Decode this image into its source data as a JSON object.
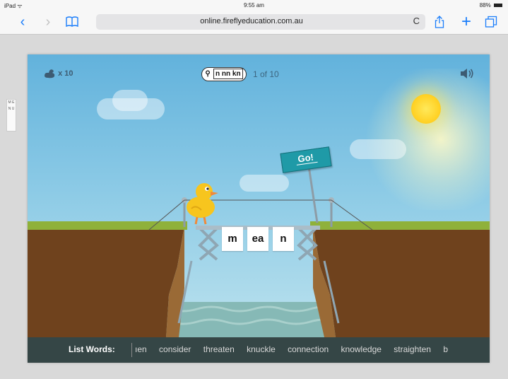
{
  "status_bar": {
    "carrier": "iPad ᯤ",
    "time": "9:55 am",
    "battery": "88%"
  },
  "browser": {
    "back": "‹",
    "forward": "›",
    "bookmarks": "📖",
    "url": "online.fireflyeducation.com.au",
    "reload": "C",
    "share": "⇧",
    "new_tab": "+",
    "tabs": "❐"
  },
  "side_tab": {
    "label": "M E N U"
  },
  "game": {
    "lives": "x 10",
    "pattern": "n nn kn",
    "progress": "1 of 10",
    "go_label": "Go!",
    "tiles": [
      "m",
      "ea",
      "n"
    ],
    "list_title": "List Words:",
    "list_words": [
      "ıen",
      "consider",
      "threaten",
      "knuckle",
      "connection",
      "knowledge",
      "straighten",
      "b"
    ]
  },
  "colors": {
    "sky_top": "#62b2dc",
    "grass": "#8fb13a",
    "dirt": "#7a4a22",
    "water": "#7fb5b5",
    "go_sign": "#1f9aa7"
  }
}
